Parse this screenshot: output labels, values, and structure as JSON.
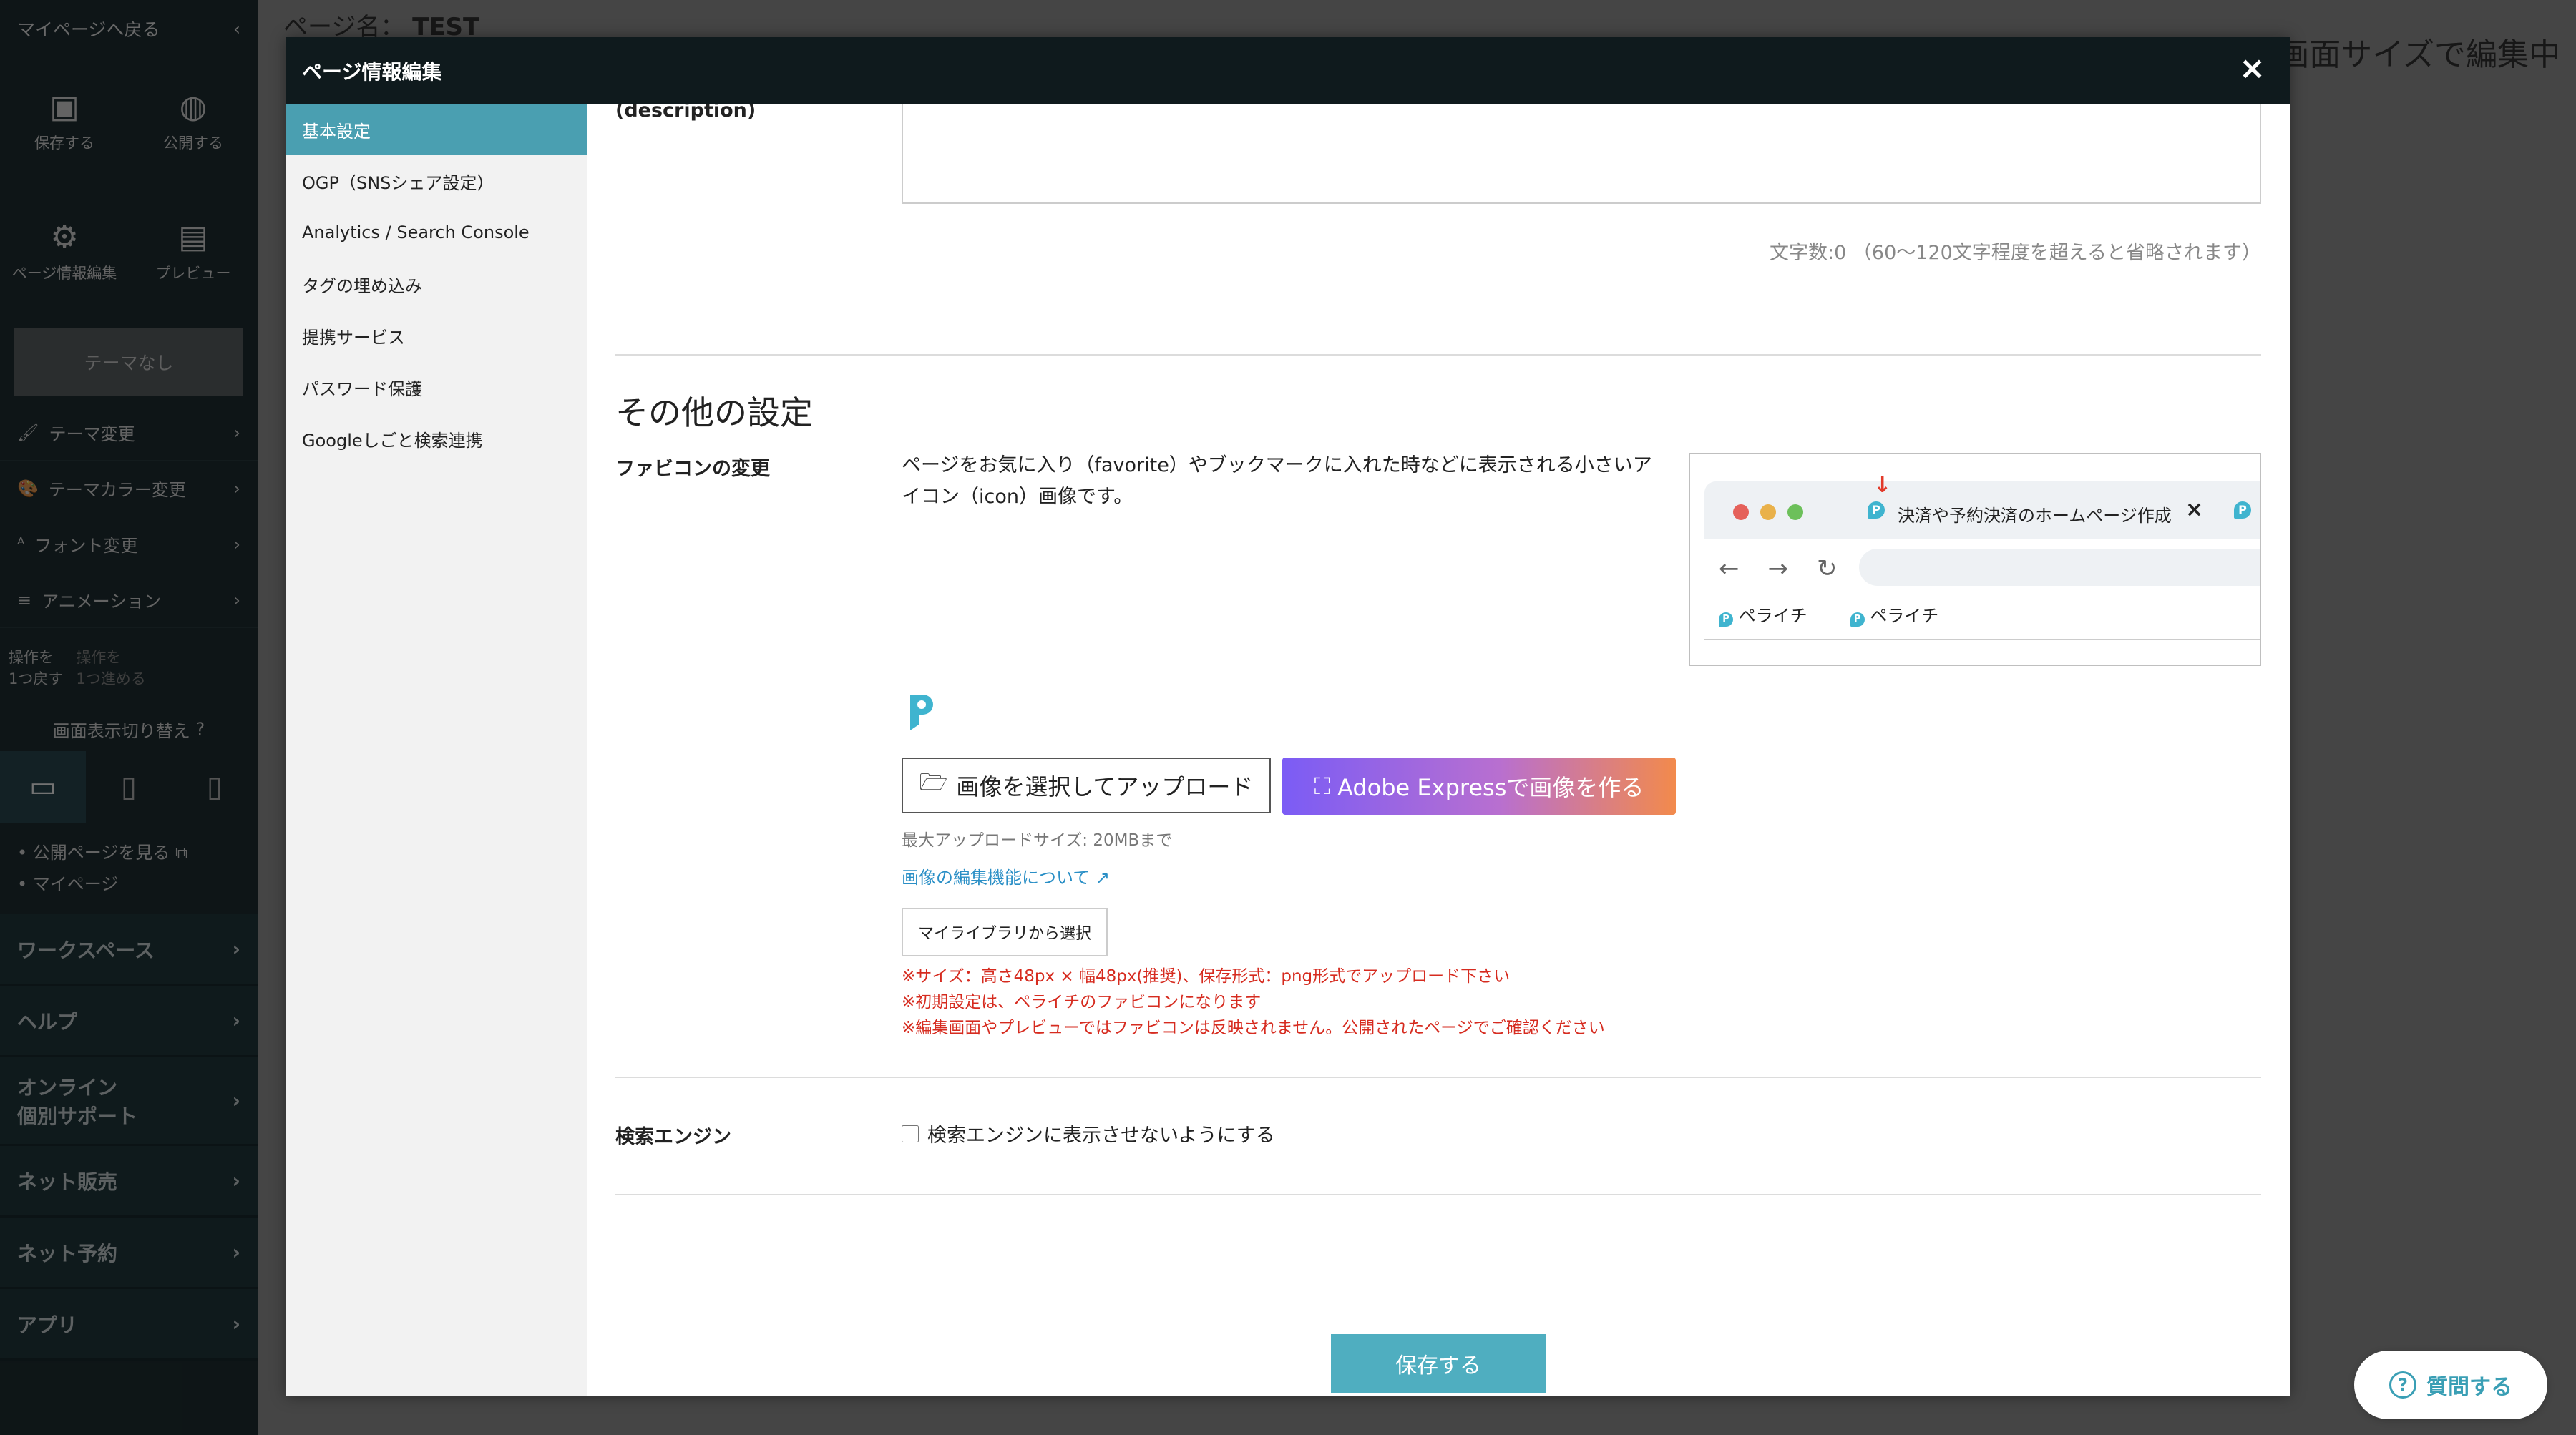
{
  "editor": {
    "back_label": "マイページへ戻る",
    "page_name_label": "ページ名：",
    "page_name": "TEST",
    "screen_size_text": "の画面サイズで編集中",
    "sidebar_icons": [
      {
        "label": "保存する",
        "icon": "save-icon",
        "glyph": "▣"
      },
      {
        "label": "公開する",
        "icon": "globe-icon",
        "glyph": "◍"
      },
      {
        "label": "ページ情報編集",
        "icon": "gear-icon",
        "glyph": "⚙"
      },
      {
        "label": "プレビュー",
        "icon": "preview-icon",
        "glyph": "▤"
      }
    ],
    "theme_none": "テーマなし",
    "menu": [
      {
        "label": "テーマ変更",
        "glyph": "🖌"
      },
      {
        "label": "テーマカラー変更",
        "glyph": "🎨"
      },
      {
        "label": "フォント変更",
        "glyph": "ᴬ"
      },
      {
        "label": "アニメーション",
        "glyph": "≡"
      }
    ],
    "undo_label": "操作を\n1つ戻す",
    "redo_label": "操作を\n1つ進める",
    "view_toggle": "画面表示切り替え",
    "links": [
      "公開ページを見る",
      "マイページ"
    ],
    "bottom_nav": [
      "ワークスペース",
      "ヘルプ",
      "オンライン\n個別サポート",
      "ネット販売",
      "ネット予約",
      "アプリ"
    ]
  },
  "modal": {
    "title": "ページ情報編集",
    "close_glyph": "×",
    "nav": [
      "基本設定",
      "OGP（SNSシェア設定）",
      "Analytics / Search Console",
      "タグの埋め込み",
      "提携サービス",
      "パスワード保護",
      "Googleしごと検索連携"
    ],
    "nav_active_index": 0,
    "description_label_partial": "(description)",
    "char_count": "文字数:0 （60〜120文字程度を超えると省略されます）",
    "other_settings_title": "その他の設定",
    "favicon": {
      "label": "ファビコンの変更",
      "description": "ページをお気に入り（favorite）やブックマークに入れた時などに表示される小さいアイコン（icon）画像です。",
      "preview_tab_text": "決済や予約決済のホームページ作成",
      "preview_bookmark": "ペライチ",
      "upload_button": "画像を選択してアップロード",
      "adobe_button": "Adobe Expressで画像を作る",
      "max_size": "最大アップロードサイズ: 20MBまで",
      "edit_link": "画像の編集機能について",
      "library_button": "マイライブラリから選択",
      "notes": [
        "※サイズ：高さ48px × 幅48px(推奨)、保存形式：png形式でアップロード下さい",
        "※初期設定は、ペライチのファビコンになります",
        "※編集画面やプレビューではファビコンは反映されません。公開されたページでご確認ください"
      ]
    },
    "search_engine": {
      "label": "検索エンジン",
      "checkbox_label": "検索エンジンに表示させないようにする",
      "checked": false
    },
    "save_button": "保存する"
  },
  "help_button": "質問する",
  "colors": {
    "accent": "#4a9fb1",
    "modal_header": "#0f1a1d",
    "note_red": "#d62b1f",
    "link_blue": "#2a8fc6"
  }
}
